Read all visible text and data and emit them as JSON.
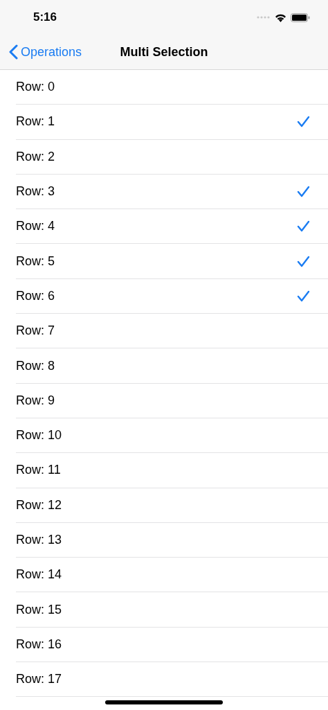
{
  "status_bar": {
    "time": "5:16"
  },
  "nav_bar": {
    "back": "Operations",
    "title": "Multi Selection"
  },
  "rows": [
    {
      "label": "Row: 0",
      "selected": false
    },
    {
      "label": "Row: 1",
      "selected": true
    },
    {
      "label": "Row: 2",
      "selected": false
    },
    {
      "label": "Row: 3",
      "selected": true
    },
    {
      "label": "Row: 4",
      "selected": true
    },
    {
      "label": "Row: 5",
      "selected": true
    },
    {
      "label": "Row: 6",
      "selected": true
    },
    {
      "label": "Row: 7",
      "selected": false
    },
    {
      "label": "Row: 8",
      "selected": false
    },
    {
      "label": "Row: 9",
      "selected": false
    },
    {
      "label": "Row: 10",
      "selected": false
    },
    {
      "label": "Row: 11",
      "selected": false
    },
    {
      "label": "Row: 12",
      "selected": false
    },
    {
      "label": "Row: 13",
      "selected": false
    },
    {
      "label": "Row: 14",
      "selected": false
    },
    {
      "label": "Row: 15",
      "selected": false
    },
    {
      "label": "Row: 16",
      "selected": false
    },
    {
      "label": "Row: 17",
      "selected": false
    }
  ]
}
